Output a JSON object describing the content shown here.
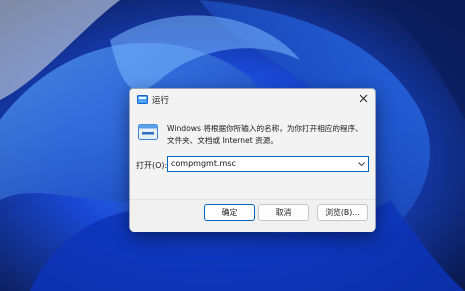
{
  "dialog": {
    "title": "运行",
    "description": "Windows 将根据你所输入的名称，为你打开相应的程序、文件夹、文档或 Internet 资源。",
    "open_label": "打开(O):",
    "command_value": "compmgmt.msc",
    "buttons": {
      "ok": "确定",
      "cancel": "取消",
      "browse": "浏览(B)..."
    },
    "icons": {
      "title": "run-icon",
      "close": "close-icon",
      "program": "run-program-icon",
      "dropdown": "chevron-down-icon"
    }
  },
  "colors": {
    "accent": "#0067c0",
    "dialog_bg": "#f3f3f3",
    "wallpaper_dark": "#0a1f6e",
    "wallpaper_bright": "#2a6cff"
  }
}
